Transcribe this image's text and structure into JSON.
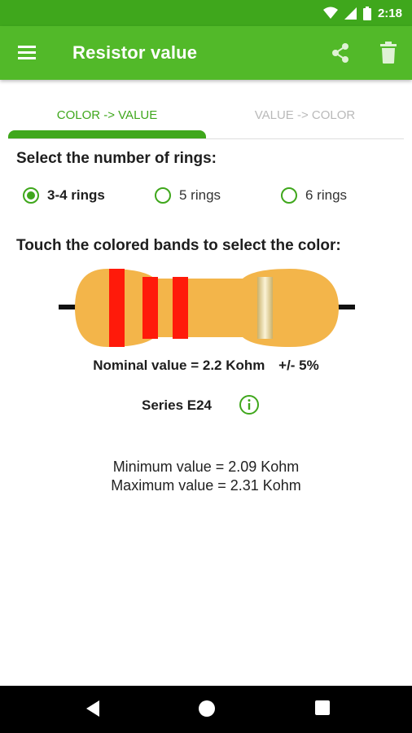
{
  "status_bar": {
    "time": "2:18"
  },
  "app_bar": {
    "title": "Resistor value"
  },
  "tabs": [
    {
      "label": "COLOR -> VALUE",
      "selected": true
    },
    {
      "label": "VALUE -> COLOR",
      "selected": false
    }
  ],
  "rings_section": {
    "title": "Select the number of rings:",
    "options": [
      {
        "label": "3-4 rings",
        "selected": true
      },
      {
        "label": "5 rings",
        "selected": false
      },
      {
        "label": "6 rings",
        "selected": false
      }
    ]
  },
  "bands_section": {
    "title": "Touch the colored bands to select the color:"
  },
  "resistor": {
    "body_color": "#f3b54a",
    "bands": [
      {
        "color": "red",
        "hex": "#ff1a0a"
      },
      {
        "color": "red",
        "hex": "#ff1a0a"
      },
      {
        "color": "red",
        "hex": "#ff1a0a"
      },
      {
        "color": "gold",
        "hex": "#e6d49a"
      }
    ]
  },
  "result": {
    "nominal": "Nominal value = 2.2 Kohm",
    "tolerance": "+/- 5%",
    "series": "Series E24",
    "minimum": "Minimum value = 2.09 Kohm",
    "maximum": "Maximum value = 2.31 Kohm"
  },
  "colors": {
    "primary": "#52b929",
    "primary_dark": "#3fa71c"
  }
}
